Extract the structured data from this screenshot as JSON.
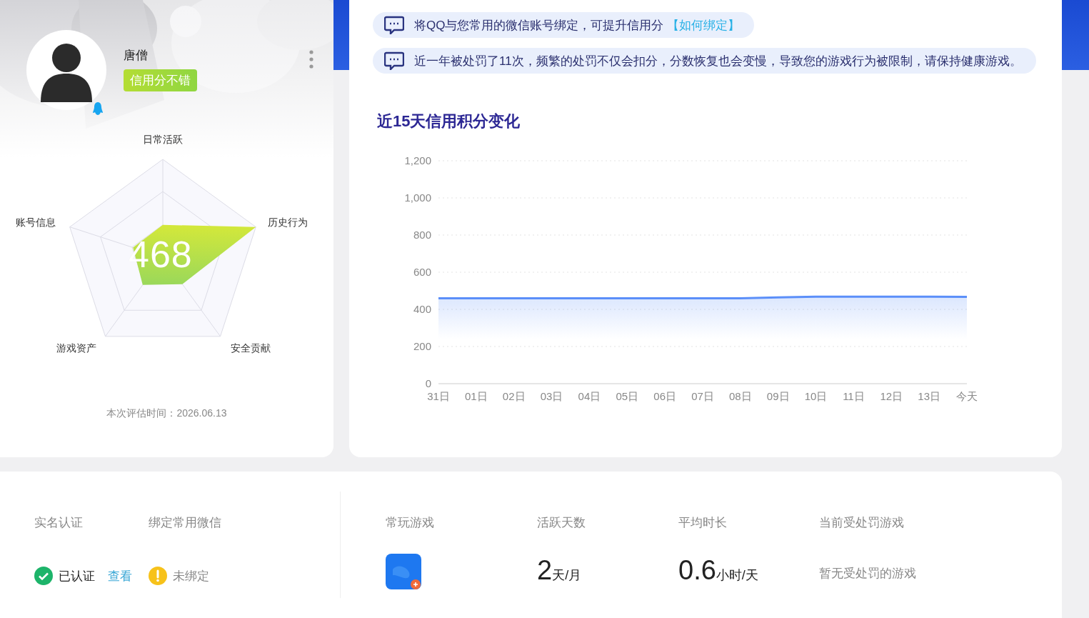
{
  "profile": {
    "name": "唐僧",
    "badge": "信用分不错",
    "score": "468",
    "radar_labels": [
      "日常活跃",
      "历史行为",
      "安全贡献",
      "游戏资产",
      "账号信息"
    ],
    "evaluated": "本次评估时间：2026.06.13"
  },
  "notices": [
    {
      "text": "将QQ与您常用的微信账号绑定，可提升信用分",
      "link": "【如何绑定】"
    },
    {
      "text": "近一年被处罚了11次，频繁的处罚不仅会扣分，分数恢复也会变慢，导致您的游戏行为被限制，请保持健康游戏。"
    }
  ],
  "chart": {
    "chart_data": {
      "type": "area",
      "title": "近15天信用积分变化",
      "categories": [
        "31日",
        "01日",
        "02日",
        "03日",
        "04日",
        "05日",
        "06日",
        "07日",
        "08日",
        "09日",
        "10日",
        "11日",
        "12日",
        "13日",
        "今天"
      ],
      "grid": true,
      "series": [
        {
          "color": "#5b8ff9",
          "values": [
            460,
            460,
            460,
            460,
            460,
            460,
            460,
            460,
            460,
            464,
            468,
            468,
            468,
            468,
            467
          ]
        }
      ],
      "ylim": [
        0,
        1200
      ],
      "yticks": [
        0,
        {
          "value": 200,
          "label": "200"
        },
        {
          "value": 400,
          "label": "400"
        },
        {
          "value": 600,
          "label": "600"
        },
        {
          "value": 800,
          "label": "800"
        },
        {
          "value": 1000,
          "label": "1,000"
        },
        {
          "value": 1200,
          "label": "1,200"
        }
      ]
    }
  },
  "account": [
    {
      "label": "实名认证",
      "kind": "ok",
      "status": "已认证",
      "link": "查看"
    },
    {
      "label": "绑定常用微信",
      "kind": "warning",
      "status": "未绑定"
    }
  ],
  "stats": [
    {
      "label": "常玩游戏",
      "kind": "games"
    },
    {
      "label": "活跃天数",
      "kind": "number",
      "value": "2",
      "unit": "天/月"
    },
    {
      "label": "平均时长",
      "kind": "number",
      "value": "0.6",
      "unit": "小时/天"
    },
    {
      "label": "当前受处罚游戏",
      "kind": "text",
      "text": "暂无受处罚的游戏"
    }
  ]
}
